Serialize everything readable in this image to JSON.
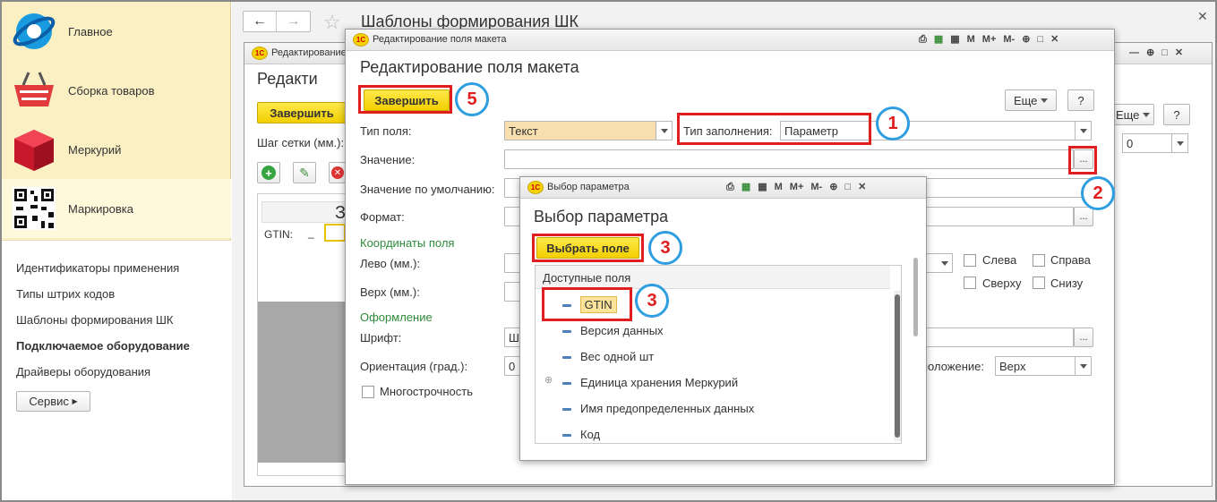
{
  "sidebar": {
    "sections": [
      {
        "label": "Главное",
        "icon": "home-globe-icon"
      },
      {
        "label": "Сборка товаров",
        "icon": "basket-icon"
      },
      {
        "label": "Меркурий",
        "icon": "cube-icon"
      },
      {
        "label": "Маркировка",
        "icon": "qr-code-icon"
      }
    ],
    "links": [
      "Идентификаторы применения",
      "Типы штрих кодов",
      "Шаблоны формирования ШК",
      "Подключаемое оборудование",
      "Драйверы оборудования"
    ],
    "service_label": "Сервис"
  },
  "main": {
    "title": "Шаблоны формирования ШК"
  },
  "bg_form": {
    "window_title": "Редактирование",
    "heading": "Редакти",
    "finish_label": "Завершить",
    "grid_label": "Шаг сетки (мм.):",
    "more_label": "Еще",
    "help_label": "?",
    "grid_value": "0",
    "preview_char": "З",
    "gtin_label": "GTIN:",
    "gtin_mark": "_"
  },
  "edit_dialog": {
    "window_title": "Редактирование поля макета",
    "heading": "Редактирование поля макета",
    "finish_label": "Завершить",
    "more_label": "Еще",
    "help_label": "?",
    "field_type_label": "Тип поля:",
    "field_type_value": "Текст",
    "fill_type_label": "Тип заполнения:",
    "fill_type_value": "Параметр",
    "value_label": "Значение:",
    "default_value_label": "Значение по умолчанию:",
    "format_label": "Формат:",
    "coords_label": "Координаты поля",
    "left_label": "Лево (мм.):",
    "top_label": "Верх (мм.):",
    "design_label": "Оформление",
    "font_label": "Шрифт:",
    "font_value": "Ш",
    "orientation_label": "Ориентация (град.):",
    "orientation_value": "0",
    "multiline_label": "Многострочность",
    "left_cb": "Слева",
    "right_cb": "Справа",
    "top_cb": "Сверху",
    "bottom_cb": "Снизу",
    "position_label": "положение:",
    "position_value": "Верх",
    "ellipsis": "..."
  },
  "param_dialog": {
    "window_title": "Выбор параметра",
    "heading": "Выбор параметра",
    "select_label": "Выбрать поле",
    "col_header": "Доступные поля",
    "items": [
      "GTIN",
      "Версия данных",
      "Вес одной шт",
      "Единица хранения Меркурий",
      "Имя предопределенных данных",
      "Код"
    ]
  },
  "toolbar_icons": {
    "m": "M",
    "mplus": "M+",
    "mminus": "M-"
  },
  "annotations": [
    "1",
    "2",
    "3",
    "3",
    "5"
  ],
  "colors": {
    "accent_yellow": "#f2cf00",
    "highlight_red": "#e01e1e",
    "badge_blue": "#2f9ee0",
    "group_green": "#2e8b3a"
  }
}
